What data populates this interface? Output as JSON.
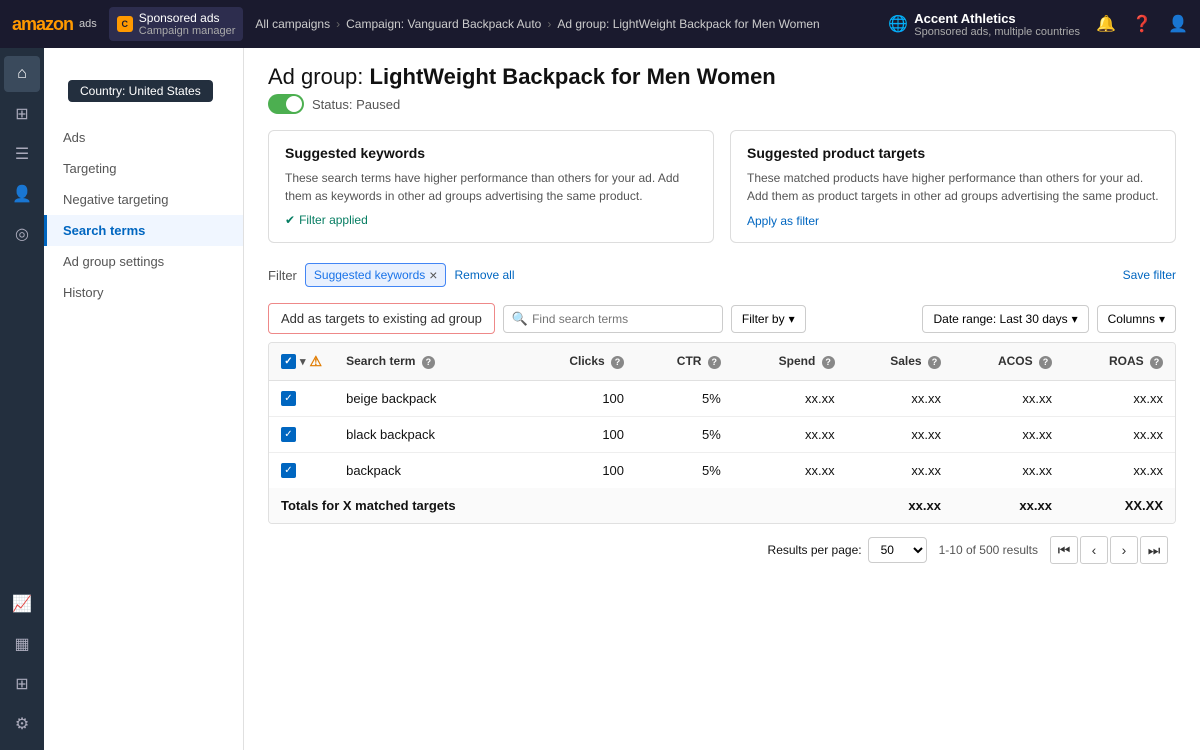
{
  "topNav": {
    "logoText": "amazon",
    "logoSub": "ads",
    "campaignManager": {
      "title": "Sponsored ads",
      "subtitle": "Campaign manager"
    },
    "breadcrumb": [
      {
        "label": "All campaigns",
        "link": true
      },
      {
        "label": "Campaign: Vanguard Backpack Auto",
        "link": true
      },
      {
        "label": "Ad group: LightWeight Backpack for Men Women",
        "link": false
      }
    ],
    "account": {
      "name": "Accent Athletics",
      "sub": "Sponsored ads, multiple countries"
    }
  },
  "countryBadge": "Country: United States",
  "pageTitle": {
    "prefix": "Ad group: ",
    "bold": "LightWeight Backpack for Men Women"
  },
  "status": {
    "label": "Status: Paused",
    "active": true
  },
  "suggestedKeywords": {
    "title": "Suggested keywords",
    "description": "These search terms have higher performance than others for your ad. Add them as keywords in other ad groups advertising the same product.",
    "filterApplied": "Filter applied"
  },
  "suggestedProductTargets": {
    "title": "Suggested product targets",
    "description": "These matched products have higher performance than others for your ad. Add them as product targets in other ad groups advertising the same product.",
    "applyFilter": "Apply as filter"
  },
  "filter": {
    "label": "Filter",
    "chip": "Suggested keywords",
    "removeAll": "Remove all",
    "saveFilter": "Save filter"
  },
  "toolbar": {
    "addTargets": "Add as targets to existing ad group",
    "searchPlaceholder": "Find search terms",
    "filterBy": "Filter by",
    "dateRange": "Date range: Last 30 days",
    "columns": "Columns"
  },
  "table": {
    "headers": [
      {
        "key": "search_term",
        "label": "Search term",
        "hasInfo": true
      },
      {
        "key": "clicks",
        "label": "Clicks",
        "hasInfo": true,
        "align": "right"
      },
      {
        "key": "ctr",
        "label": "CTR",
        "hasInfo": true,
        "align": "right"
      },
      {
        "key": "spend",
        "label": "Spend",
        "hasInfo": true,
        "align": "right"
      },
      {
        "key": "sales",
        "label": "Sales",
        "hasInfo": true,
        "align": "right"
      },
      {
        "key": "acos",
        "label": "ACOS",
        "hasInfo": true,
        "align": "right"
      },
      {
        "key": "roas",
        "label": "ROAS",
        "hasInfo": true,
        "align": "right"
      }
    ],
    "rows": [
      {
        "id": 1,
        "checked": true,
        "search_term": "beige backpack",
        "clicks": "100",
        "ctr": "5%",
        "spend": "xx.xx",
        "sales": "xx.xx",
        "acos": "xx.xx",
        "roas": "xx.xx"
      },
      {
        "id": 2,
        "checked": true,
        "search_term": "black backpack",
        "clicks": "100",
        "ctr": "5%",
        "spend": "xx.xx",
        "sales": "xx.xx",
        "acos": "xx.xx",
        "roas": "xx.xx"
      },
      {
        "id": 3,
        "checked": true,
        "search_term": "backpack",
        "clicks": "100",
        "ctr": "5%",
        "spend": "xx.xx",
        "sales": "xx.xx",
        "acos": "xx.xx",
        "roas": "xx.xx"
      }
    ],
    "totals": {
      "label": "Totals for X matched targets",
      "acos": "xx.xx",
      "roas": "XX.XX"
    }
  },
  "pagination": {
    "resultsPerPage": "Results per page:",
    "perPageValue": "50",
    "resultsText": "1-10 of 500 results"
  },
  "leftNav": {
    "items": [
      {
        "label": "Ads",
        "active": false
      },
      {
        "label": "Targeting",
        "active": false
      },
      {
        "label": "Negative targeting",
        "active": false
      },
      {
        "label": "Search terms",
        "active": true
      },
      {
        "label": "Ad group settings",
        "active": false
      },
      {
        "label": "History",
        "active": false
      }
    ]
  },
  "sidebarIcons": [
    {
      "name": "home-icon",
      "glyph": "⌂"
    },
    {
      "name": "grid-icon",
      "glyph": "⊞"
    },
    {
      "name": "list-icon",
      "glyph": "☰"
    },
    {
      "name": "person-icon",
      "glyph": "👤"
    },
    {
      "name": "targeting-icon",
      "glyph": "◎"
    },
    {
      "name": "chart-icon",
      "glyph": "📈"
    },
    {
      "name": "bar-icon",
      "glyph": "▦"
    },
    {
      "name": "apps-icon",
      "glyph": "⊞"
    },
    {
      "name": "settings-icon",
      "glyph": "⚙"
    }
  ]
}
